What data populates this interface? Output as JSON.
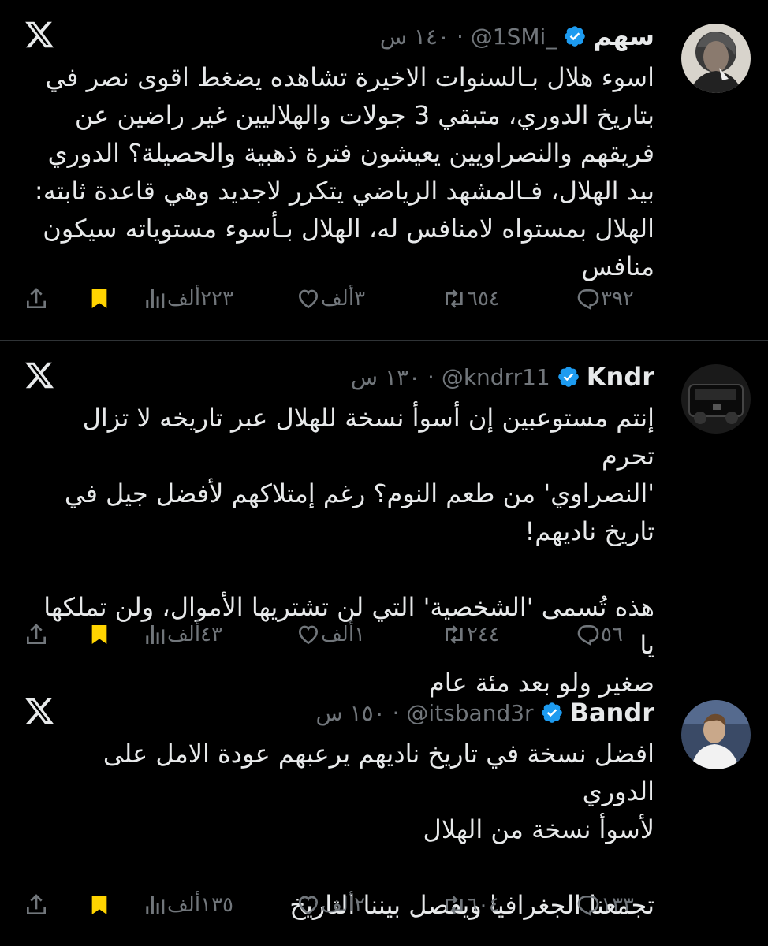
{
  "colors": {
    "background": "#000000",
    "text": "#e7e9ea",
    "muted": "#71767b",
    "verified": "#1d9bf0",
    "bookmark": "#ffd400",
    "divider": "#2f3336"
  },
  "tweets": [
    {
      "name": "سهم",
      "handle": "@1SMi_",
      "time": "١٤٠ س",
      "text": "اسوء هلال بـالسنوات الاخيرة تشاهده يضغط اقوى نصر في\nبتاريخ الدوري، متبقي 3 جولات والهلاليين غير راضين عن\nفريقهم والنصراويين يعيشون فترة ذهبية والحصيلة؟ الدوري\nبيد الهلال، فـالمشهد الرياضي يتكرر لاجديد وهي قاعدة ثابته:\nالهلال بمستواه لامنافس له، الهلال بـأسوء مستوياته سيكون\nمنافس",
      "replies": "٣٩٢",
      "retweets": "٦٥٤",
      "likes": "٣ألف",
      "views": "٢٢٣ألف"
    },
    {
      "name": "Kndr",
      "handle": "@kndrr11",
      "time": "١٣٠ س",
      "text": "إنتم مستوعبين إن أسوأ نسخة للهلال عبر تاريخه لا تزال تحرم\n'النصراوي' من طعم النوم؟ رغم إمتلاكهم لأفضل جيل في\nتاريخ ناديهم!\n\nهذه تُسمى 'الشخصية' التي لن تشتريها الأموال، ولن تملكها يا\nصغير ولو بعد مئة عام",
      "replies": "٥٦",
      "retweets": "٢٤٤",
      "likes": "١ألف",
      "views": "٤٣ألف"
    },
    {
      "name": "Bandr",
      "handle": "@itsband3r",
      "time": "١٥٠ س",
      "text": "افضل نسخة في تاريخ ناديهم يرعبهم عودة الامل على الدوري\nلأسوأ نسخة من الهلال\n\nتجمعنا الجغرافيا ويفصل بيننا التاريخ",
      "replies": "١٣٣",
      "retweets": "٦٠٤",
      "likes": "٢ألف",
      "views": "١٣٥ألف"
    }
  ]
}
